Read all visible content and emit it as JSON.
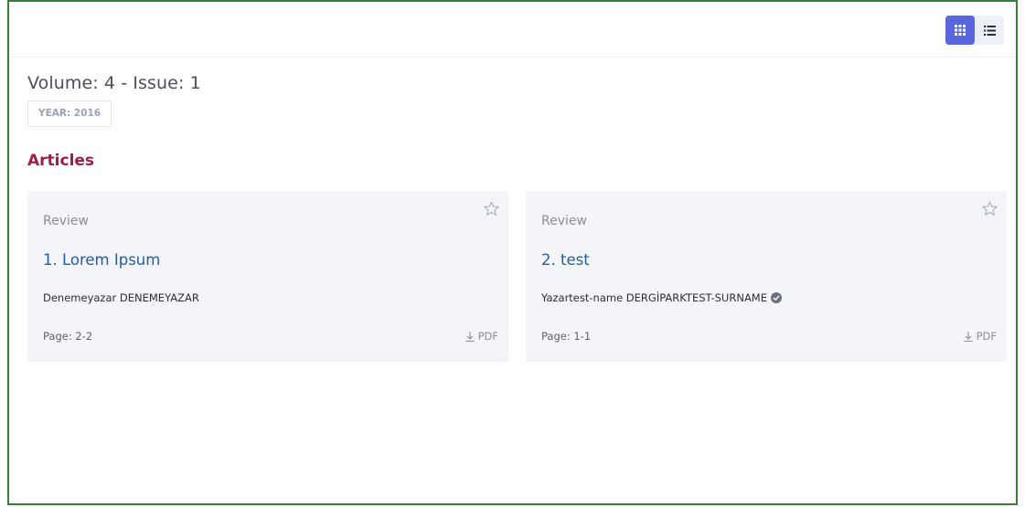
{
  "issue": {
    "title": "Volume: 4 - Issue: 1",
    "year": "YEAR: 2016"
  },
  "section": {
    "title": "Articles"
  },
  "view_toggle": {
    "grid_icon": "grid-icon",
    "list_icon": "list-icon",
    "active": "grid"
  },
  "articles": [
    {
      "type": "Review",
      "title": "1. Lorem Ipsum",
      "authors": "Denemeyazar DENEMEYAZAR",
      "verified": false,
      "page": "Page: 2-2",
      "pdf_label": "PDF"
    },
    {
      "type": "Review",
      "title": "2. test",
      "authors": "Yazartest-name DERGİPARKTEST-SURNAME",
      "verified": true,
      "page": "Page: 1-1",
      "pdf_label": "PDF"
    }
  ],
  "colors": {
    "accent": "#5867dd",
    "section_title": "#9d1c4a",
    "link": "#1e5fa8",
    "frame_border": "#3b7d3b"
  }
}
